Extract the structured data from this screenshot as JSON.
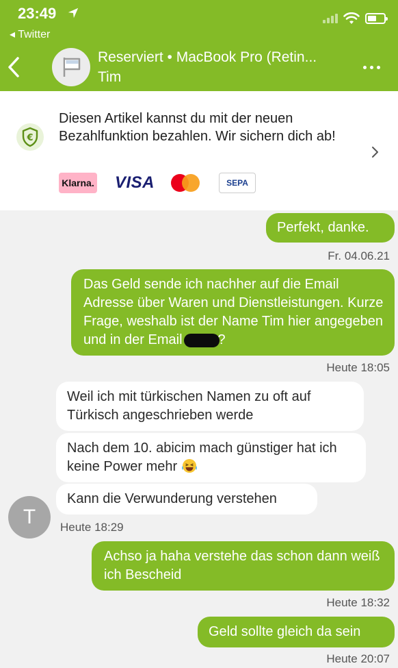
{
  "status": {
    "time": "23:49",
    "back_app": "◂ Twitter"
  },
  "conversation": {
    "title": "Reserviert • MacBook Pro (Retin...",
    "subtitle": "Tim"
  },
  "banner": {
    "text": "Diesen Artikel kannst du mit der neuen Bezahlfunktion bezahlen. Wir sichern dich ab!",
    "payment_methods": [
      "Klarna.",
      "VISA",
      "Mastercard",
      "SEPA"
    ],
    "klarna": "Klarna.",
    "visa": "VISA",
    "sepa": "SEPA"
  },
  "messages": {
    "m1": "Perfekt, danke.",
    "t1": "Fr. 04.06.21",
    "m2a": "Das Geld sende ich nachher auf die Email Adresse über Waren und Dienstleistungen. Kurze Frage, weshalb ist der Name Tim hier angegeben und in der Email",
    "m2b": "?",
    "t2": "Heute 18:05",
    "m3": "Weil ich mit türkischen Namen zu oft auf Türkisch angeschrieben werde",
    "m4": "Nach dem 10. abicim mach günstiger hat ich keine Power mehr",
    "m5": "Kann die Verwunderung verstehen",
    "avatar_letter": "T",
    "t3": "Heute 18:29",
    "m6": "Achso ja haha verstehe das schon dann weiß ich Bescheid",
    "t4": "Heute 18:32",
    "m7": "Geld sollte gleich da sein",
    "t5": "Heute 20:07"
  },
  "colors": {
    "accent": "#84bb27",
    "background": "#f1f1f1",
    "bubble_other": "#ffffff"
  },
  "icons": [
    "location-arrow-icon",
    "wifi-icon",
    "battery-icon",
    "back-chevron-icon",
    "flag-icon",
    "more-icon",
    "euro-shield-icon",
    "chevron-right-icon",
    "laughing-emoji-icon"
  ]
}
